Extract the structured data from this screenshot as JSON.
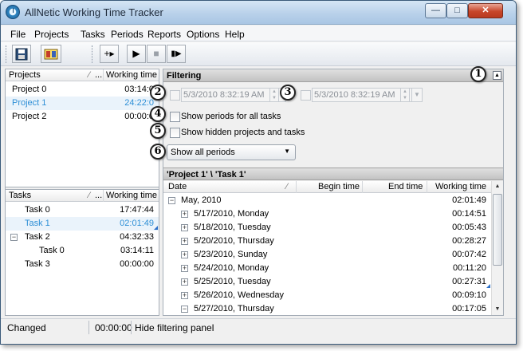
{
  "window": {
    "title": "AllNetic Working Time Tracker",
    "close_glyph": "✕",
    "max_glyph": "□",
    "min_glyph": "—"
  },
  "menu": [
    "File",
    "Projects",
    "Tasks",
    "Periods",
    "Reports",
    "Options",
    "Help"
  ],
  "toolbar": {
    "save_icon": "save-icon",
    "filter_icon": "filter-icon",
    "add_glyph": "+▸",
    "play_glyph": "▶",
    "stop_glyph": "■",
    "step_glyph": "▮▶"
  },
  "projects": {
    "headers": {
      "name": "Projects",
      "dots": "...",
      "time": "Working time"
    },
    "rows": [
      {
        "name": "Project 0",
        "time": "03:14:0"
      },
      {
        "name": "Project 1",
        "time": "24:22:0",
        "selected": true
      },
      {
        "name": "Project 2",
        "time": "00:00:0"
      }
    ]
  },
  "tasks": {
    "headers": {
      "name": "Tasks",
      "dots": "...",
      "time": "Working time"
    },
    "rows": [
      {
        "name": "Task 0",
        "time": "17:47:44"
      },
      {
        "name": "Task 1",
        "time": "02:01:49",
        "selected": true
      },
      {
        "name": "Task 2",
        "time": "04:32:33",
        "expand": "−"
      },
      {
        "name": "Task 0",
        "time": "03:14:11",
        "child": true
      },
      {
        "name": "Task 3",
        "time": "00:00:00"
      }
    ]
  },
  "filter": {
    "title": "Filtering",
    "collapse_glyph": "▲",
    "start_date": "5/3/2010 8:32:19 AM",
    "end_date": "5/3/2010 8:32:19 AM",
    "show_all_tasks_label": "Show periods for all tasks",
    "show_hidden_label": "Show hidden projects and tasks",
    "period_select": "Show all periods",
    "dropdown_glyph": "▼"
  },
  "badges": [
    "1",
    "2",
    "3",
    "4",
    "5",
    "6"
  ],
  "periods": {
    "title": "'Project 1' \\ 'Task 1'",
    "headers": {
      "date": "Date",
      "begin": "Begin time",
      "end": "End time",
      "time": "Working time"
    },
    "group": {
      "label": "May, 2010",
      "time": "02:01:49",
      "expand": "−"
    },
    "rows": [
      {
        "label": "5/17/2010, Monday",
        "time": "00:14:51",
        "expand": "+"
      },
      {
        "label": "5/18/2010, Tuesday",
        "time": "00:05:43",
        "expand": "+"
      },
      {
        "label": "5/20/2010, Thursday",
        "time": "00:28:27",
        "expand": "+"
      },
      {
        "label": "5/23/2010, Sunday",
        "time": "00:07:42",
        "expand": "+"
      },
      {
        "label": "5/24/2010, Monday",
        "time": "00:11:20",
        "expand": "+"
      },
      {
        "label": "5/25/2010, Tuesday",
        "time": "00:27:31",
        "expand": "+"
      },
      {
        "label": "5/26/2010, Wednesday",
        "time": "00:09:10",
        "expand": "+"
      },
      {
        "label": "5/27/2010, Thursday",
        "time": "00:17:05",
        "expand": "−"
      }
    ]
  },
  "status": {
    "state": "Changed",
    "time": "00:00:00",
    "hint": "Hide filtering panel"
  }
}
